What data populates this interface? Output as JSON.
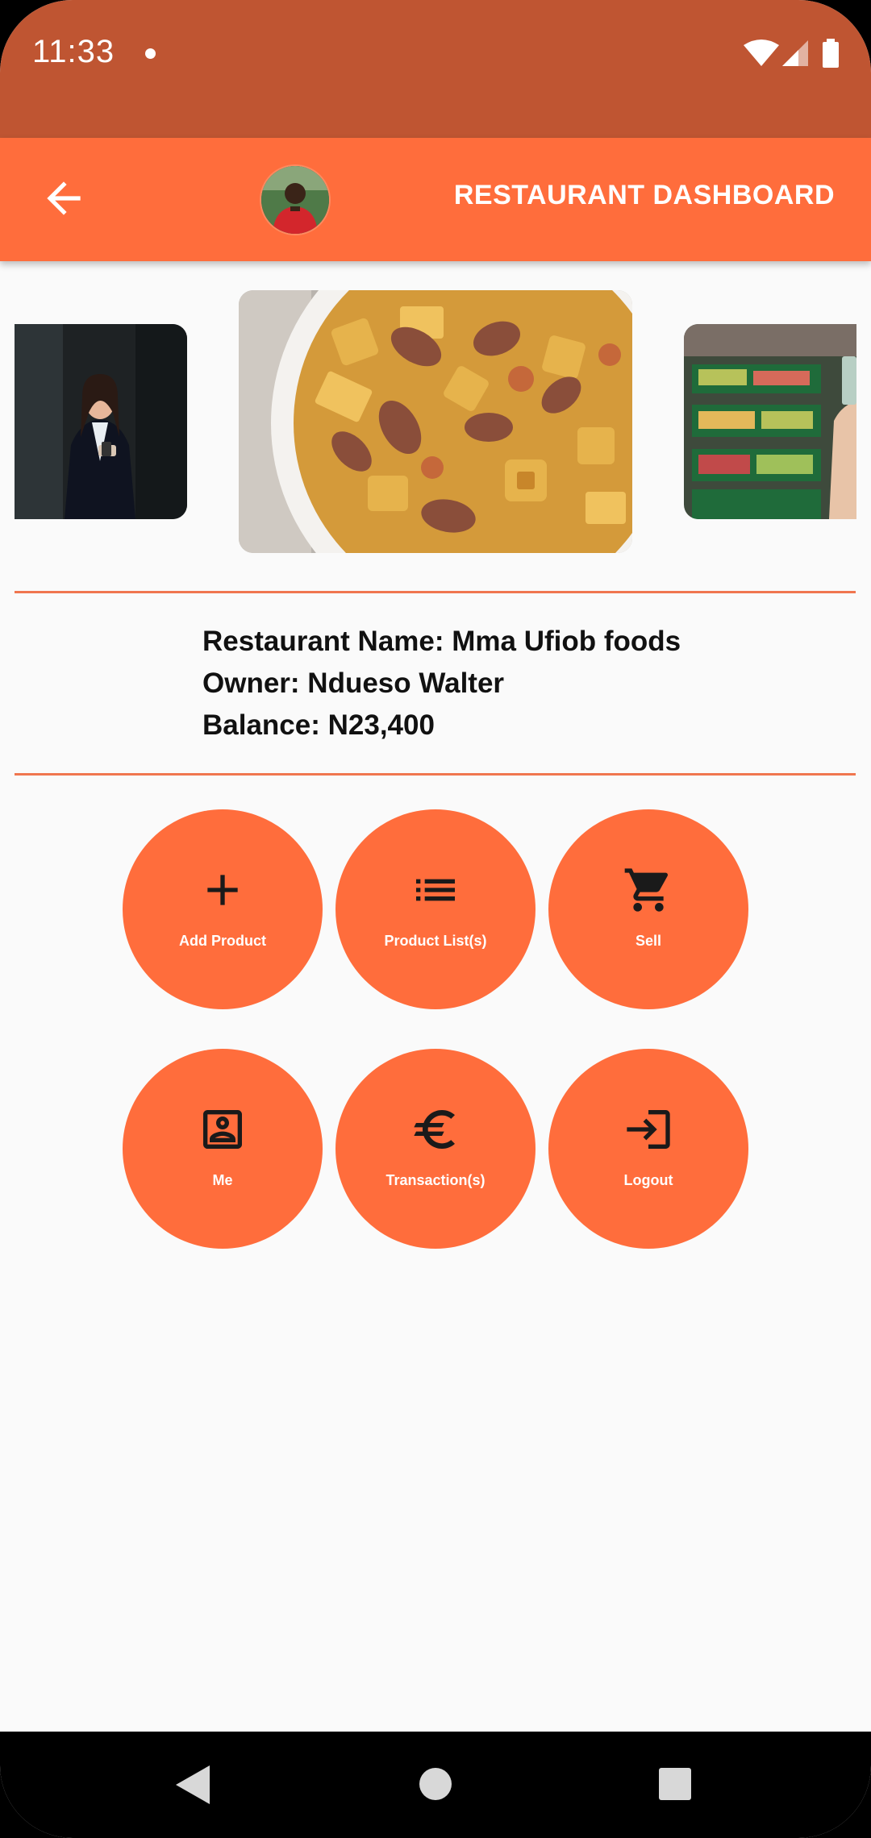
{
  "status_bar": {
    "time": "11:33"
  },
  "app_bar": {
    "title": "RESTAURANT DASHBOARD",
    "back_icon": "arrow-left-icon",
    "avatar": "user-avatar"
  },
  "carousel": {
    "slides": [
      "woman-with-phone",
      "snack-mix-bowl",
      "supermarket-produce"
    ]
  },
  "restaurant": {
    "name_line": "Restaurant Name: Mma Ufiob foods",
    "owner_line": "Owner: Ndueso Walter",
    "balance_line": "Balance: N23,400"
  },
  "actions": [
    {
      "label": "Add Product",
      "icon": "plus-icon"
    },
    {
      "label": "Product List(s)",
      "icon": "list-icon"
    },
    {
      "label": "Sell",
      "icon": "cart-icon"
    },
    {
      "label": "Me",
      "icon": "contact-card-icon"
    },
    {
      "label": "Transaction(s)",
      "icon": "euro-icon"
    },
    {
      "label": "Logout",
      "icon": "login-icon"
    }
  ],
  "colors": {
    "status_bar": "#bf5532",
    "primary": "#ff6d3c",
    "background": "#fafafa",
    "divider": "#f0764f"
  }
}
